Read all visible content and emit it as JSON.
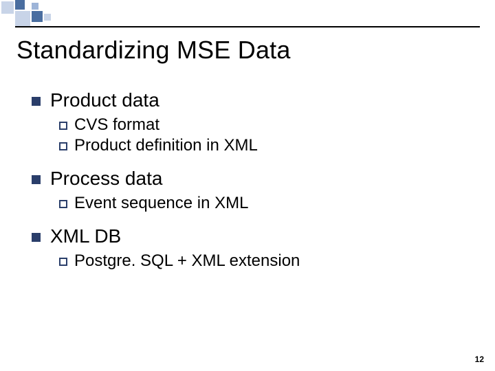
{
  "slide": {
    "title": "Standardizing MSE Data",
    "page_number": "12",
    "items": [
      {
        "label": "Product data",
        "sub": [
          "CVS format",
          "Product definition in XML"
        ]
      },
      {
        "label": "Process data",
        "sub": [
          "Event sequence in XML"
        ]
      },
      {
        "label": "XML DB",
        "sub": [
          "Postgre. SQL + XML extension"
        ]
      }
    ]
  }
}
